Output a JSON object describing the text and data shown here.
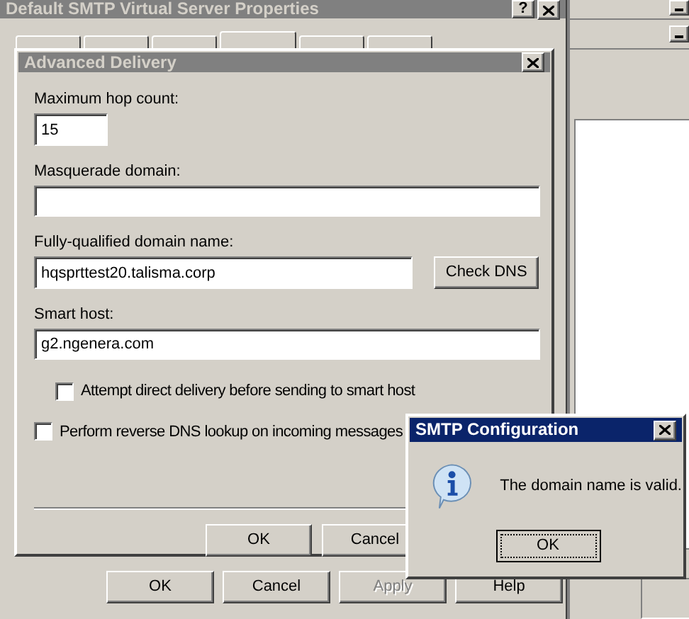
{
  "main_window": {
    "title": "Default SMTP Virtual Server Properties",
    "active": false,
    "help_label": "?",
    "tabs": [
      {
        "selected": false
      },
      {
        "selected": false
      },
      {
        "selected": false
      },
      {
        "selected": true
      },
      {
        "selected": false
      },
      {
        "selected": false
      }
    ],
    "buttons": [
      {
        "label": "OK",
        "disabled": false
      },
      {
        "label": "Cancel",
        "disabled": false
      },
      {
        "label": "Apply",
        "disabled": true
      },
      {
        "label": "Help",
        "disabled": false
      }
    ]
  },
  "dialog": {
    "title": "Advanced Delivery",
    "active": false,
    "fields": [
      {
        "kind": "short",
        "label": "Maximum hop count:",
        "value": "15"
      },
      {
        "kind": "wide",
        "label": "Masquerade domain:"
      },
      {
        "kind": "with_button",
        "label": "Fully-qualified domain name:",
        "value": "hqsprttest20.talisma.corp",
        "button": "Check DNS"
      },
      {
        "kind": "wide",
        "label": "Smart host:",
        "value": "g2.ngenera.com",
        "option": {
          "label": "Attempt direct delivery before sending to smart host",
          "checked": false
        }
      }
    ],
    "checkboxes": [
      {
        "label": "Perform reverse DNS lookup on incoming messages",
        "checked": false
      }
    ],
    "buttons": [
      {
        "label": "OK"
      },
      {
        "label": "Cancel"
      }
    ]
  },
  "message_box": {
    "title": "SMTP Configuration",
    "active": true,
    "message": "The domain name is valid.",
    "button": "OK"
  }
}
